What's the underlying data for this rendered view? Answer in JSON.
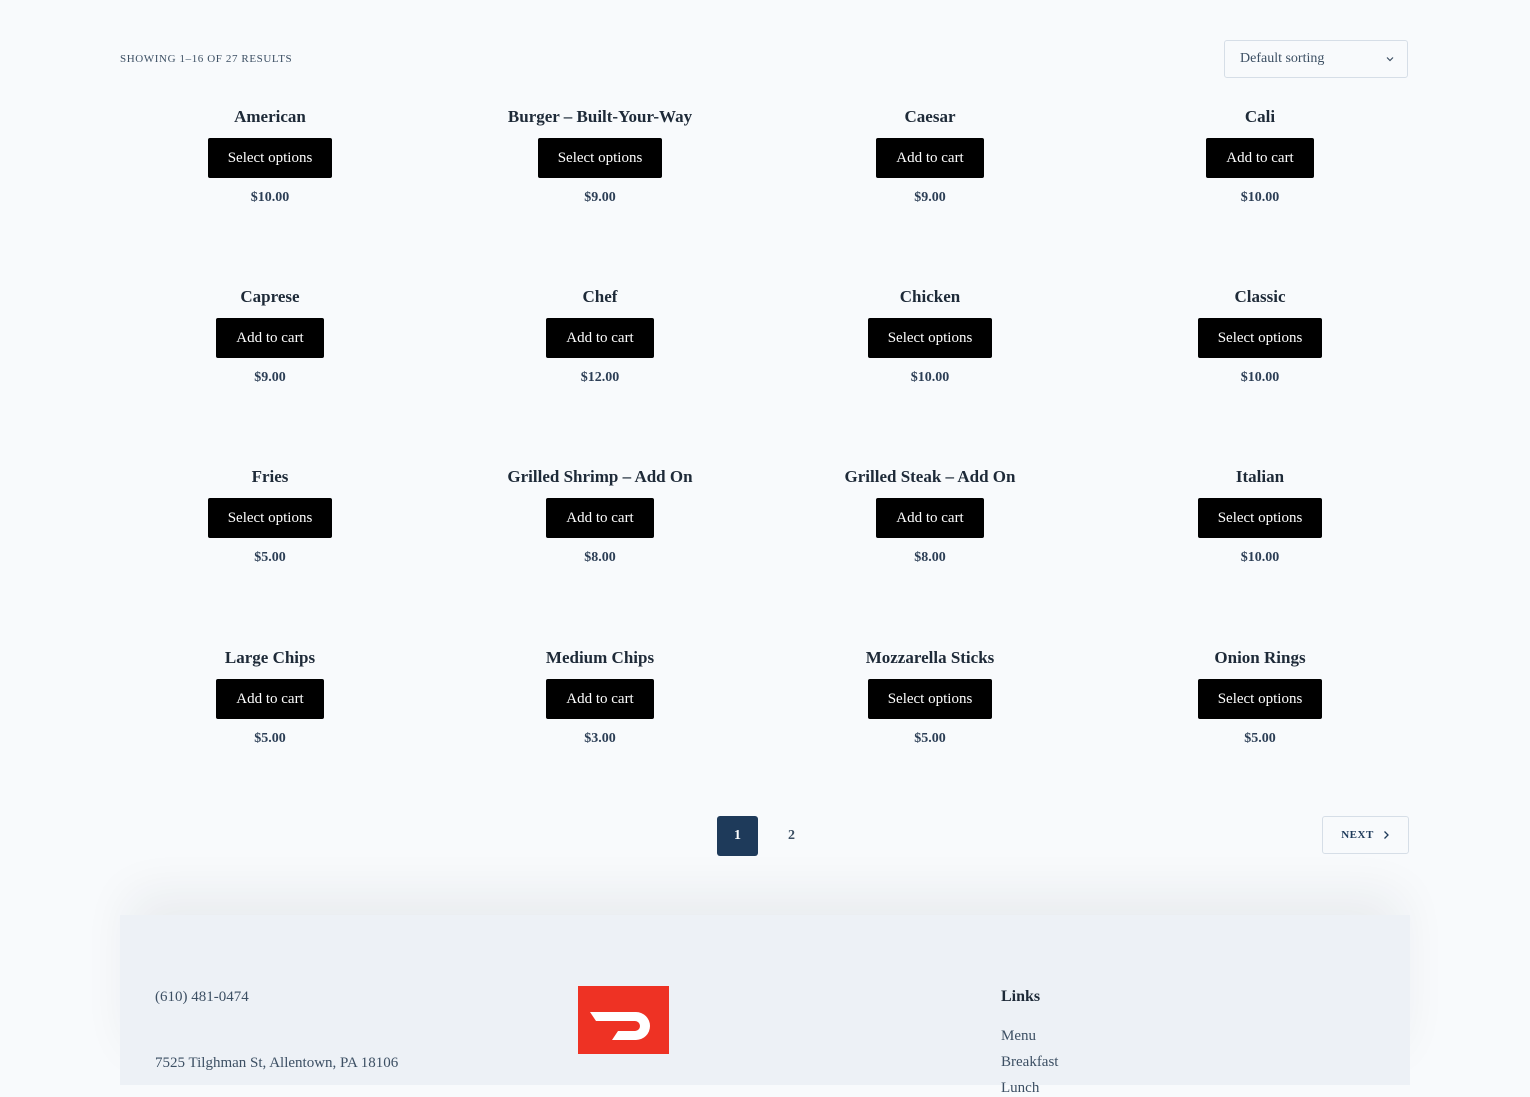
{
  "toolbar": {
    "results_text": "Showing 1–16 of 27 results",
    "sort_selected": "Default sorting"
  },
  "products": [
    {
      "name": "American",
      "button": "Select options",
      "price": "$10.00"
    },
    {
      "name": "Burger – Built-Your-Way",
      "button": "Select options",
      "price": "$9.00"
    },
    {
      "name": "Caesar",
      "button": "Add to cart",
      "price": "$9.00"
    },
    {
      "name": "Cali",
      "button": "Add to cart",
      "price": "$10.00"
    },
    {
      "name": "Caprese",
      "button": "Add to cart",
      "price": "$9.00"
    },
    {
      "name": "Chef",
      "button": "Add to cart",
      "price": "$12.00"
    },
    {
      "name": "Chicken",
      "button": "Select options",
      "price": "$10.00"
    },
    {
      "name": "Classic",
      "button": "Select options",
      "price": "$10.00"
    },
    {
      "name": "Fries",
      "button": "Select options",
      "price": "$5.00"
    },
    {
      "name": "Grilled Shrimp – Add On",
      "button": "Add to cart",
      "price": "$8.00"
    },
    {
      "name": "Grilled Steak – Add On",
      "button": "Add to cart",
      "price": "$8.00"
    },
    {
      "name": "Italian",
      "button": "Select options",
      "price": "$10.00"
    },
    {
      "name": "Large Chips",
      "button": "Add to cart",
      "price": "$5.00"
    },
    {
      "name": "Medium Chips",
      "button": "Add to cart",
      "price": "$3.00"
    },
    {
      "name": "Mozzarella Sticks",
      "button": "Select options",
      "price": "$5.00"
    },
    {
      "name": "Onion Rings",
      "button": "Select options",
      "price": "$5.00"
    }
  ],
  "pagination": {
    "pages": [
      "1",
      "2"
    ],
    "current": "1",
    "next_label": "Next"
  },
  "footer": {
    "phone": "(610) 481-0474",
    "address": "7525 Tilghman St, Allentown, PA 18106",
    "logo_icon": "doordash-logo",
    "links_title": "Links",
    "links": [
      "Menu",
      "Breakfast",
      "Lunch"
    ]
  },
  "colors": {
    "background": "#f8fafc",
    "button": "#000000",
    "page_active": "#1e3a5a",
    "logo": "#ee3224"
  }
}
